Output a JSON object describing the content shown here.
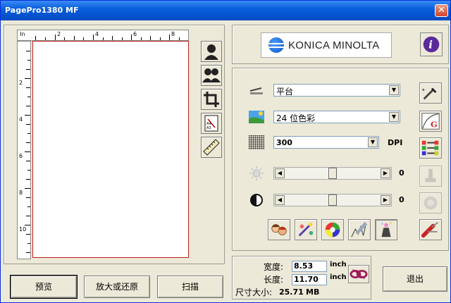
{
  "window": {
    "title": "PagePro1380 MF",
    "close_label": "✕"
  },
  "ruler": {
    "unit": "In",
    "top_ticks": [
      "2",
      "4",
      "6",
      "8"
    ],
    "left_ticks": [
      "2",
      "4",
      "6",
      "8",
      "10"
    ]
  },
  "logo": {
    "brand": "KONICA MINOLTA"
  },
  "settings": {
    "source": "平台",
    "color_mode": "24 位色彩",
    "resolution": "300",
    "resolution_unit": "DPI",
    "brightness": "0",
    "contrast": "0"
  },
  "size": {
    "width_label": "宽度:",
    "width_value": "8.53",
    "width_unit": "inch",
    "length_label": "长度:",
    "length_value": "11.70",
    "length_unit": "inch",
    "filesize_label": "尺寸大小:",
    "filesize_value": "25.71",
    "filesize_unit": "MB"
  },
  "buttons": {
    "preview": "预览",
    "zoom": "放大或还原",
    "scan": "扫描",
    "exit": "退出"
  }
}
